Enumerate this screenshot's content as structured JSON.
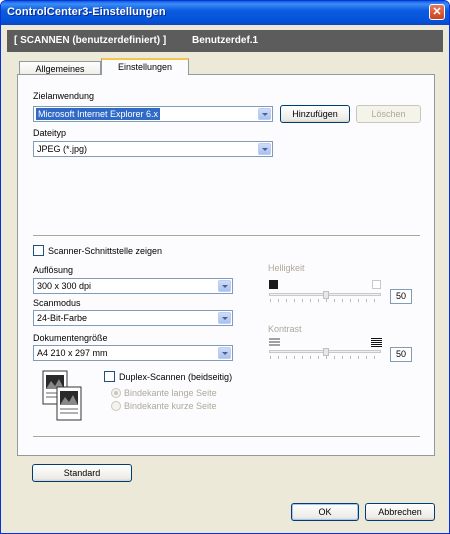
{
  "window": {
    "title": "ControlCenter3-Einstellungen",
    "close_glyph": "✕"
  },
  "banner": {
    "section": "[  SCANNEN (benutzerdefiniert)  ]",
    "button_name": "Benutzerdef.1"
  },
  "tabs": [
    {
      "label": "Allgemeines"
    },
    {
      "label": "Einstellungen"
    }
  ],
  "target_app": {
    "label": "Zielanwendung",
    "value": "Microsoft Internet Explorer 6.x",
    "add_label": "Hinzufügen",
    "delete_label": "Löschen"
  },
  "file_type": {
    "label": "Dateityp",
    "value": "JPEG (*.jpg)"
  },
  "scanner_interface": {
    "label": "Scanner-Schnittstelle zeigen",
    "checked": false
  },
  "resolution": {
    "label": "Auflösung",
    "value": "300 x 300 dpi"
  },
  "scan_mode": {
    "label": "Scanmodus",
    "value": "24-Bit-Farbe"
  },
  "doc_size": {
    "label": "Dokumentengröße",
    "value": "A4 210 x 297 mm"
  },
  "brightness": {
    "label": "Helligkeit",
    "value": "50",
    "level": 0.5
  },
  "contrast": {
    "label": "Kontrast",
    "value": "50",
    "level": 0.5
  },
  "duplex": {
    "label": "Duplex-Scannen (beidseitig)",
    "checked": false,
    "options": [
      {
        "label": "Bindekante lange Seite",
        "selected": true
      },
      {
        "label": "Bindekante kurze Seite",
        "selected": false
      }
    ]
  },
  "buttons": {
    "standard": "Standard",
    "ok": "OK",
    "cancel": "Abbrechen"
  },
  "colors": {
    "title_bar": "#0a5de3",
    "banner": "#5c5c5c",
    "selection": "#316ac5",
    "tab_highlight": "#f4c54e"
  },
  "icons": {
    "brightness_low": "black-square-icon",
    "brightness_high": "white-square-icon",
    "contrast_low": "low-contrast-icon",
    "contrast_high": "high-contrast-icon",
    "duplex": "duplex-pages-icon"
  }
}
